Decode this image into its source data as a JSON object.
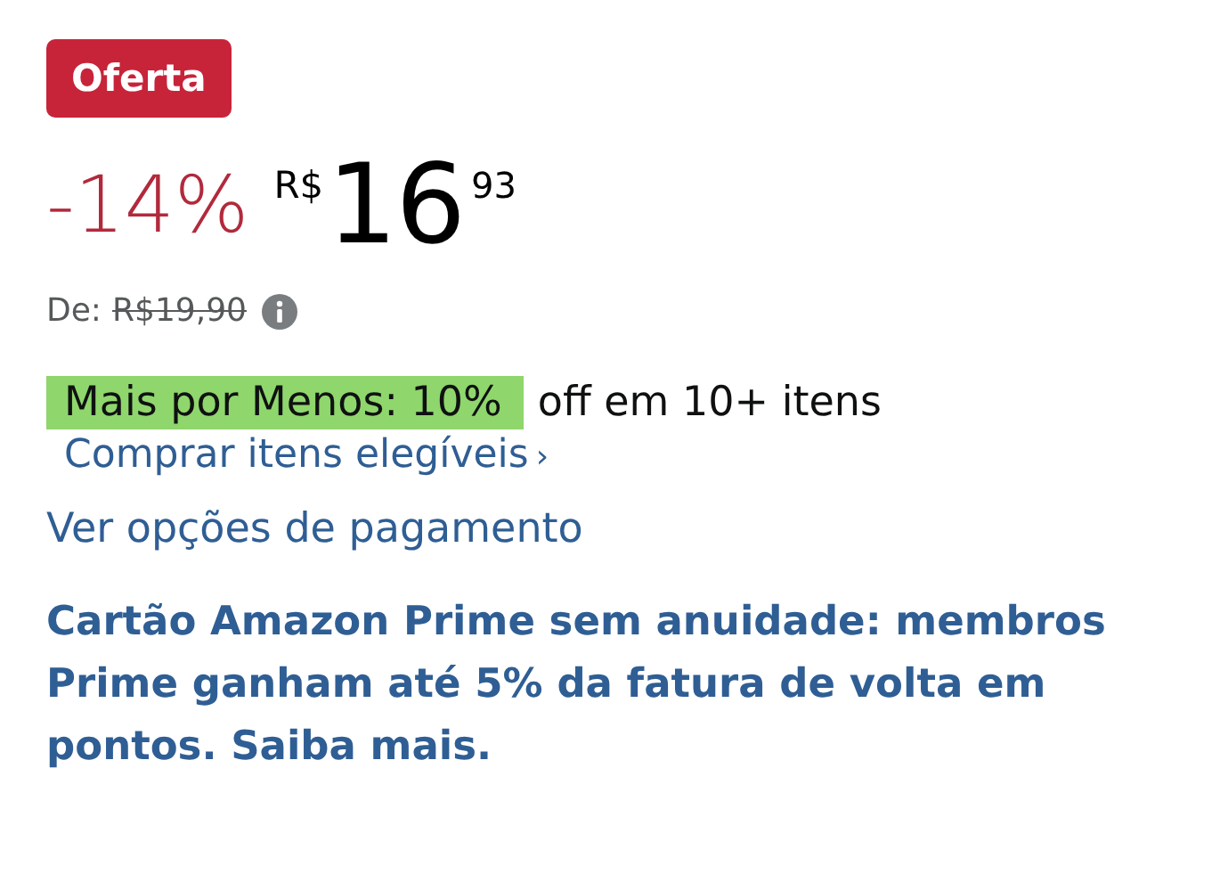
{
  "badge": "Oferta",
  "discount": "-14%",
  "price": {
    "currency": "R$",
    "whole": "16",
    "cents": "93"
  },
  "list_price": {
    "label": "De:",
    "value": "R$19,90"
  },
  "promo": {
    "highlight": "Mais por Menos: 10%",
    "text": "off em 10+ itens"
  },
  "shop_link": {
    "label": "Comprar itens elegíveis",
    "chevron": "›"
  },
  "payment_link": "Ver opções de pagamento",
  "card_offer": "Cartão Amazon Prime sem anuidade: membros Prime ganham até 5% da fatura de volta em pontos. Saiba mais."
}
